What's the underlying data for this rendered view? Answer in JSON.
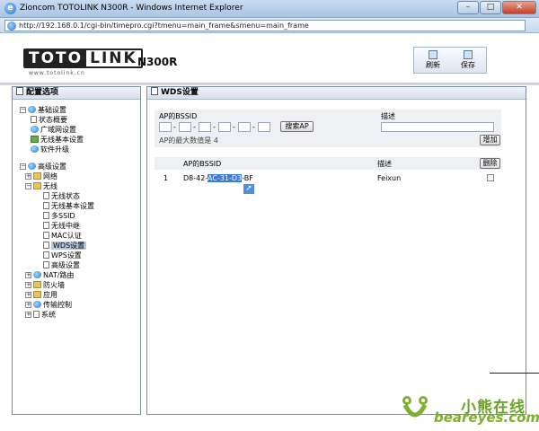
{
  "window": {
    "title": "Zioncom TOTOLINK N300R - Windows Internet Explorer",
    "minimize": "–",
    "maximize": "□",
    "close": "✕"
  },
  "address": {
    "url": "http://192.168.0.1/cgi-bin/timepro.cgi?tmenu=main_frame&smenu=main_frame"
  },
  "header": {
    "logo_a": "TOTO",
    "logo_b": "LINK",
    "logo_sub": "www.totolink.cn",
    "model": "N300R",
    "refresh_label": "刷新",
    "save_label": "保存"
  },
  "sidebar": {
    "title": "配置选项",
    "items": [
      {
        "label": "基础设置"
      },
      {
        "label": "状态概要"
      },
      {
        "label": "广域网设置"
      },
      {
        "label": "无线基本设置"
      },
      {
        "label": "软件升级"
      },
      {
        "label": "高级设置"
      },
      {
        "label": "网络"
      },
      {
        "label": "无线"
      },
      {
        "label": "无线状态"
      },
      {
        "label": "无线基本设置"
      },
      {
        "label": "多SSID"
      },
      {
        "label": "无线中继"
      },
      {
        "label": "MAC认证"
      },
      {
        "label": "WDS设置"
      },
      {
        "label": "WPS设置"
      },
      {
        "label": "高级设置"
      },
      {
        "label": "NAT/路由"
      },
      {
        "label": "防火墙"
      },
      {
        "label": "应用"
      },
      {
        "label": "传输控制"
      },
      {
        "label": "系统"
      }
    ]
  },
  "main": {
    "title": "WDS设置",
    "form": {
      "bssid_header": "AP的BSSID",
      "desc_header": "描述",
      "search_button": "搜索AP",
      "hint": "AP的最大数值是 4",
      "add_button": "增加"
    },
    "list": {
      "bssid_header": "AP的BSSID",
      "desc_header": "描述",
      "delete_button": "删除",
      "rows": [
        {
          "index": "1",
          "bssid_prefix": "D8-42-",
          "bssid_selected": "AC-31-D3",
          "bssid_suffix": "-BF",
          "desc": "Feixun"
        }
      ]
    }
  },
  "watermark": {
    "cn": "小熊在线",
    "en": "beareyes.com"
  },
  "colors": {
    "selection": "#3c79d8",
    "brand_green": "#7db12d"
  }
}
